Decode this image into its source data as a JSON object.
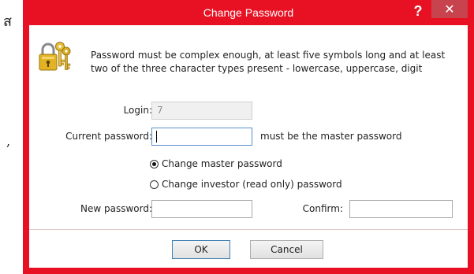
{
  "background": {
    "glyph_1": "ส",
    "glyph_2": ","
  },
  "window": {
    "title": "Change Password",
    "help_label": "?",
    "close_label": "✕",
    "accent_color": "#e81123"
  },
  "description": "Password must be complex enough, at least five symbols long and at least two of the three character types present - lowercase, uppercase, digit",
  "login": {
    "label": "Login:",
    "value": "7"
  },
  "current_password": {
    "label": "Current password:",
    "value": "",
    "hint": "must be the master password"
  },
  "options": [
    {
      "label": "Change master password",
      "checked": true
    },
    {
      "label": "Change investor (read only) password",
      "checked": false
    }
  ],
  "new_password": {
    "label": "New password:",
    "value": ""
  },
  "confirm": {
    "label": "Confirm:",
    "value": ""
  },
  "buttons": {
    "ok": "OK",
    "cancel": "Cancel"
  },
  "icon": "keys-lock-icon"
}
